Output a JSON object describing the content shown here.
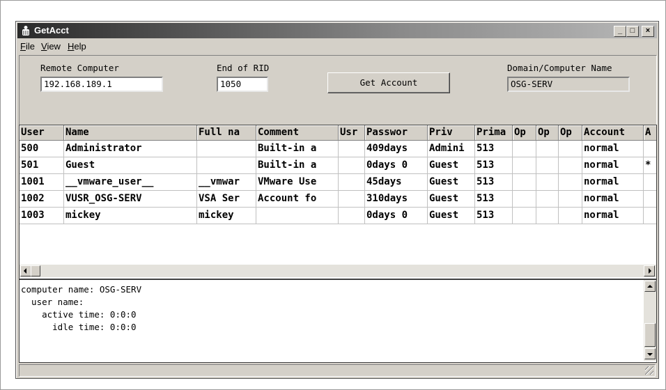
{
  "window": {
    "title": "GetAcct",
    "minimize_glyph": "_",
    "maximize_glyph": "□",
    "close_glyph": "×"
  },
  "menu": [
    "File",
    "View",
    "Help"
  ],
  "form": {
    "remote_computer_label": "Remote Computer",
    "remote_computer_value": "192.168.189.1",
    "end_rid_label": "End of RID",
    "end_rid_value": "1050",
    "get_account_button": "Get Account",
    "domain_label": "Domain/Computer Name",
    "domain_value": "OSG-SERV"
  },
  "table": {
    "columns": [
      "User",
      "Name",
      "Full na",
      "Comment",
      "Usr",
      "Passwor",
      "Priv",
      "Prima",
      "Op",
      "Op",
      "Op",
      "Account",
      "A"
    ],
    "rows": [
      [
        "500",
        "Administrator",
        "",
        "Built-in a",
        "",
        "409days",
        "Admini",
        "513",
        "",
        "",
        "",
        "normal",
        ""
      ],
      [
        "501",
        "Guest",
        "",
        "Built-in a",
        "",
        "0days 0",
        "Guest",
        "513",
        "",
        "",
        "",
        "normal",
        "*"
      ],
      [
        "1001",
        "__vmware_user__",
        "__vmwar",
        "VMware Use",
        "",
        "45days",
        "Guest",
        "513",
        "",
        "",
        "",
        "normal",
        ""
      ],
      [
        "1002",
        "VUSR_OSG-SERV",
        "VSA Ser",
        "Account fo",
        "",
        "310days",
        "Guest",
        "513",
        "",
        "",
        "",
        "normal",
        ""
      ],
      [
        "1003",
        "mickey",
        "mickey",
        "",
        "",
        "0days 0",
        "Guest",
        "513",
        "",
        "",
        "",
        "normal",
        ""
      ]
    ]
  },
  "output_lines": [
    "computer name: OSG-SERV",
    "  user name:",
    "    active time: 0:0:0",
    "      idle time: 0:0:0"
  ],
  "icons": {
    "app": "getacct-app-icon",
    "scroll_left": "scroll-left-arrow-icon",
    "scroll_right": "scroll-right-arrow-icon",
    "scroll_up": "scroll-up-arrow-icon",
    "scroll_down": "scroll-down-arrow-icon",
    "size_grip": "size-grip-icon"
  },
  "colors": {
    "window_face": "#d4d0c8",
    "title_gradient_start": "#2a2a2a",
    "title_gradient_end": "#b8b8b8"
  }
}
